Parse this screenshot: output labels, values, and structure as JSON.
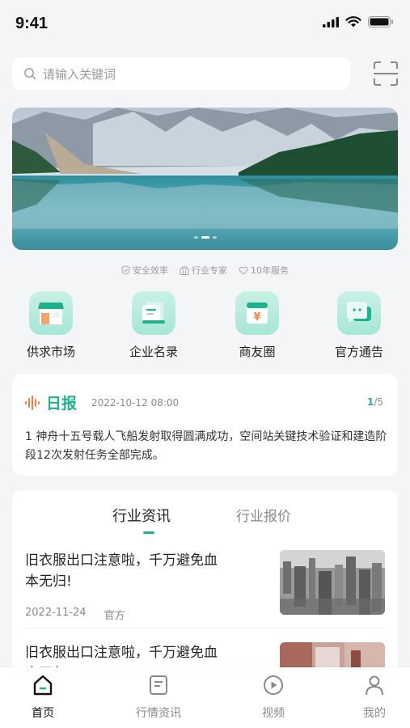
{
  "status_bar": {
    "time": "9:41"
  },
  "search": {
    "placeholder": "请输入关键词"
  },
  "features": [
    "安全效率",
    "行业专家",
    "10年服务"
  ],
  "quick_links": [
    {
      "label": "供求市场",
      "icon": "shop-icon"
    },
    {
      "label": "企业名录",
      "icon": "directory-icon"
    },
    {
      "label": "商友圈",
      "icon": "yuan-calendar-icon"
    },
    {
      "label": "官方通告",
      "icon": "chat-bubble-icon"
    }
  ],
  "daily": {
    "title": "日报",
    "date": "2022-10-12 08:00",
    "page_current": "1",
    "page_total": "/5",
    "text": "1 神舟十五号载人飞船发射取得圆满成功，空间站关键技术验证和建造阶段12次发射任务全部完成。"
  },
  "news": {
    "tabs": [
      "行业资讯",
      "行业报价"
    ],
    "items": [
      {
        "title": "旧衣服出口注意啦，千万避免血本无归!",
        "date": "2022-11-24",
        "source": "官方"
      },
      {
        "title": "旧衣服出口注意啦，千万避免血本无归!",
        "date": "",
        "source": ""
      }
    ]
  },
  "tabbar": [
    {
      "label": "首页",
      "icon": "home-icon",
      "active": true
    },
    {
      "label": "行情资讯",
      "icon": "document-icon",
      "active": false
    },
    {
      "label": "视频",
      "icon": "play-icon",
      "active": false
    },
    {
      "label": "我的",
      "icon": "person-icon",
      "active": false
    }
  ],
  "colors": {
    "accent": "#1fb18d",
    "icon_bg": "#b8ecdd"
  }
}
